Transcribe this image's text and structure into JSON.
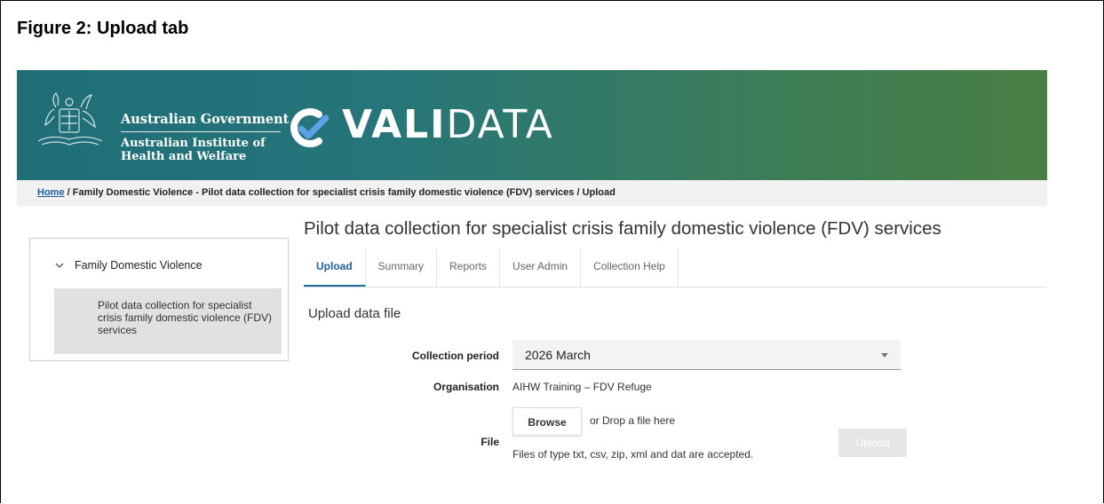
{
  "figure_title": "Figure 2: Upload tab",
  "header": {
    "gov_line1": "Australian Government",
    "gov_line2a": "Australian Institute of",
    "gov_line2b": "Health and Welfare",
    "app_name_bold": "VALI",
    "app_name_light": "DATA",
    "crest_icon": "coat-of-arms-icon",
    "logo_icon": "validata-check-icon"
  },
  "breadcrumb": {
    "home": "Home",
    "rest": " / Family Domestic Violence - Pilot data collection for specialist crisis family domestic violence (FDV) services / Upload"
  },
  "sidebar": {
    "group_label": "Family Domestic Violence",
    "item_label": "Pilot data collection for specialist crisis family domestic violence (FDV) services"
  },
  "main": {
    "title": "Pilot data collection for specialist crisis family domestic violence (FDV) services",
    "tabs": [
      {
        "label": "Upload",
        "active": true
      },
      {
        "label": "Summary",
        "active": false
      },
      {
        "label": "Reports",
        "active": false
      },
      {
        "label": "User Admin",
        "active": false
      },
      {
        "label": "Collection Help",
        "active": false
      }
    ],
    "section_title": "Upload data file",
    "form": {
      "collection_period_label": "Collection period",
      "collection_period_value": "2026 March",
      "organisation_label": "Organisation",
      "organisation_value": "AIHW Training – FDV Refuge",
      "file_label": "File",
      "browse_label": "Browse",
      "drop_text": "or Drop a file here",
      "file_hint": "Files of type txt, csv, zip, xml and dat are accepted.",
      "upload_label": "Upload"
    }
  },
  "colors": {
    "header_start": "#1f6e78",
    "header_end": "#4a7f44",
    "active_tab": "#1f5f9f",
    "link": "#1f5f9f"
  }
}
